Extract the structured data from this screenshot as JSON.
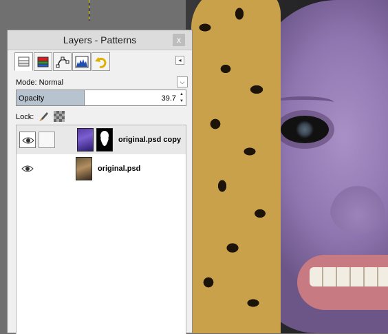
{
  "panel": {
    "title": "Layers - Patterns",
    "close_glyph": "x",
    "tab_menu_glyph": "◂",
    "tabs": [
      {
        "icon": "layers-icon",
        "active": true
      },
      {
        "icon": "channels-icon",
        "active": false
      },
      {
        "icon": "paths-icon",
        "active": false
      },
      {
        "icon": "histogram-icon",
        "active": false
      },
      {
        "icon": "undo-history-icon",
        "active": false
      }
    ]
  },
  "mode": {
    "label": "Mode:",
    "value": "Normal"
  },
  "opacity": {
    "label": "Opacity",
    "value": "39.7",
    "fraction": 0.397
  },
  "lock": {
    "label": "Lock:"
  },
  "layers": [
    {
      "name": "original.psd copy",
      "visible": true,
      "selected": true,
      "has_mask": true
    },
    {
      "name": "original.psd",
      "visible": true,
      "selected": false,
      "has_mask": false
    }
  ],
  "colors": {
    "accent": "#b7c3ce",
    "selected_row": "#e8e8e8"
  }
}
